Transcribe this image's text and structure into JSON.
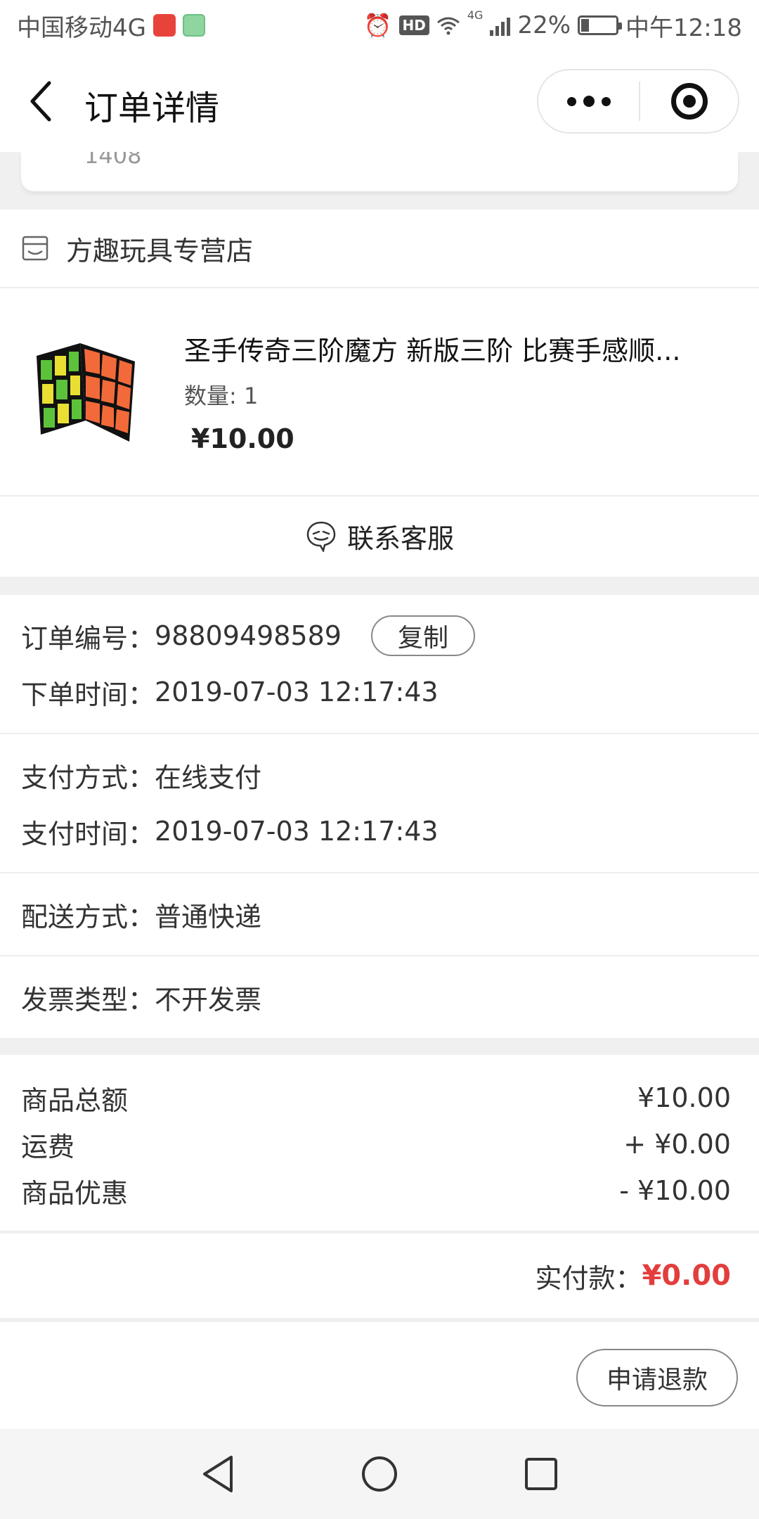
{
  "status_bar": {
    "carrier": "中国移动4G",
    "battery": "22%",
    "battery_level": 0.22,
    "time": "中午12:18",
    "network": "4G",
    "hd": "HD"
  },
  "nav": {
    "title": "订单详情"
  },
  "address": {
    "partial_text": "1408"
  },
  "shop": {
    "name": "方趣玩具专营店"
  },
  "product": {
    "title": "圣手传奇三阶魔方 新版三阶 比赛手感顺...",
    "quantity": "数量: 1",
    "price": "¥10.00"
  },
  "service": {
    "label": "联系客服"
  },
  "order_info": {
    "order_no_key": "订单编号：",
    "order_no": "98809498589",
    "copy_label": "复制",
    "order_time_key": "下单时间：",
    "order_time": "2019-07-03 12:17:43",
    "pay_method_key": "支付方式：",
    "pay_method": "在线支付",
    "pay_time_key": "支付时间：",
    "pay_time": "2019-07-03 12:17:43",
    "delivery_key": "配送方式：",
    "delivery": "普通快递",
    "invoice_key": "发票类型：",
    "invoice": "不开发票"
  },
  "summary": {
    "goods_total_label": "商品总额",
    "goods_total": "¥10.00",
    "shipping_label": "运费",
    "shipping": "+ ¥0.00",
    "discount_label": "商品优惠",
    "discount": "- ¥10.00",
    "paid_label": "实付款：",
    "paid": "¥0.00"
  },
  "actions": {
    "refund": "申请退款"
  },
  "colors": {
    "accent_red": "#e33d3d"
  }
}
